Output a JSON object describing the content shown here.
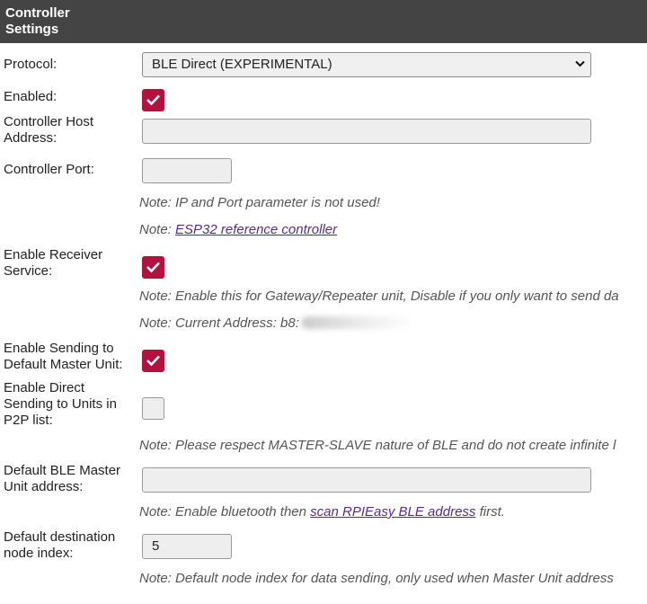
{
  "header": {
    "title": "Controller Settings"
  },
  "protocol": {
    "label": "Protocol:",
    "selected": "BLE Direct (EXPERIMENTAL)"
  },
  "enabled": {
    "label": "Enabled:",
    "checked": true
  },
  "host": {
    "label": "Controller Host Address:",
    "value": ""
  },
  "port": {
    "label": "Controller Port:",
    "value": ""
  },
  "notes": {
    "ip_port": "Note: IP and Port parameter is not used!",
    "esp32_prefix": "Note: ",
    "esp32_link": "ESP32 reference controller",
    "receiver": "Note: Enable this for Gateway/Repeater unit, Disable if you only want to send da",
    "current_address": "Note: Current Address: b8:",
    "p2p": "Note: Please respect MASTER-SLAVE nature of BLE and do not create infinite l",
    "bt_prefix": "Note: Enable bluetooth then ",
    "bt_link": "scan RPIEasy BLE address",
    "bt_suffix": " first.",
    "node_index": "Note: Default node index for data sending, only used when Master Unit address"
  },
  "receiver": {
    "label": "Enable Receiver Service:",
    "checked": true
  },
  "send_master": {
    "label": "Enable Sending to Default Master Unit:",
    "checked": true
  },
  "send_p2p": {
    "label": "Enable Direct Sending to Units in P2P list:",
    "checked": false
  },
  "master_addr": {
    "label": "Default BLE Master Unit address:",
    "value": ""
  },
  "dest_node": {
    "label": "Default destination node index:",
    "value": "5"
  },
  "colors": {
    "header_bg": "#444444",
    "checkbox_on": "#b3123e",
    "link": "#5b2a86"
  }
}
